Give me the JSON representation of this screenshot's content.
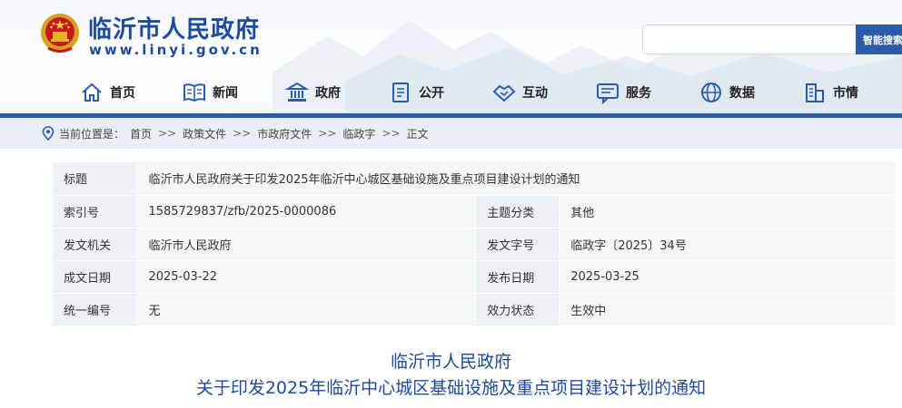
{
  "site": {
    "name": "临沂市人民政府",
    "domain": "www.linyi.gov.cn",
    "search_placeholder": "",
    "search_button": "智能搜索",
    "accent_color": "#2a5cab",
    "title_color": "#1d4a9a"
  },
  "nav": [
    {
      "label": "首页",
      "icon": "home-icon"
    },
    {
      "label": "新闻",
      "icon": "newspaper-icon"
    },
    {
      "label": "政府",
      "icon": "government-building-icon"
    },
    {
      "label": "公开",
      "icon": "document-icon"
    },
    {
      "label": "互动",
      "icon": "handshake-icon"
    },
    {
      "label": "服务",
      "icon": "service-chat-icon"
    },
    {
      "label": "数据",
      "icon": "data-globe-icon"
    },
    {
      "label": "市情",
      "icon": "city-buildings-icon"
    }
  ],
  "breadcrumb": {
    "prefix": "当前位置是：",
    "separator": ">>",
    "items": [
      "首页",
      "政策文件",
      "市政府文件",
      "临政字",
      "正文"
    ]
  },
  "info": {
    "title_label": "标题",
    "title_value": "临沂市人民政府关于印发2025年临沂中心城区基础设施及重点项目建设计划的通知",
    "rows": [
      {
        "k1": "索引号",
        "v1": "1585729837/zfb/2025-0000086",
        "k2": "主题分类",
        "v2": "其他"
      },
      {
        "k1": "发文机关",
        "v1": "临沂市人民政府",
        "k2": "发文字号",
        "v2": "临政字〔2025〕34号"
      },
      {
        "k1": "成文日期",
        "v1": "2025-03-22",
        "k2": "发布日期",
        "v2": "2025-03-25"
      },
      {
        "k1": "统一编号",
        "v1": "无",
        "k2": "效力状态",
        "v2": "生效中"
      }
    ]
  },
  "document": {
    "title_line1": "临沂市人民政府",
    "title_line2": "关于印发2025年临沂中心城区基础设施及重点项目建设计划的通知"
  }
}
